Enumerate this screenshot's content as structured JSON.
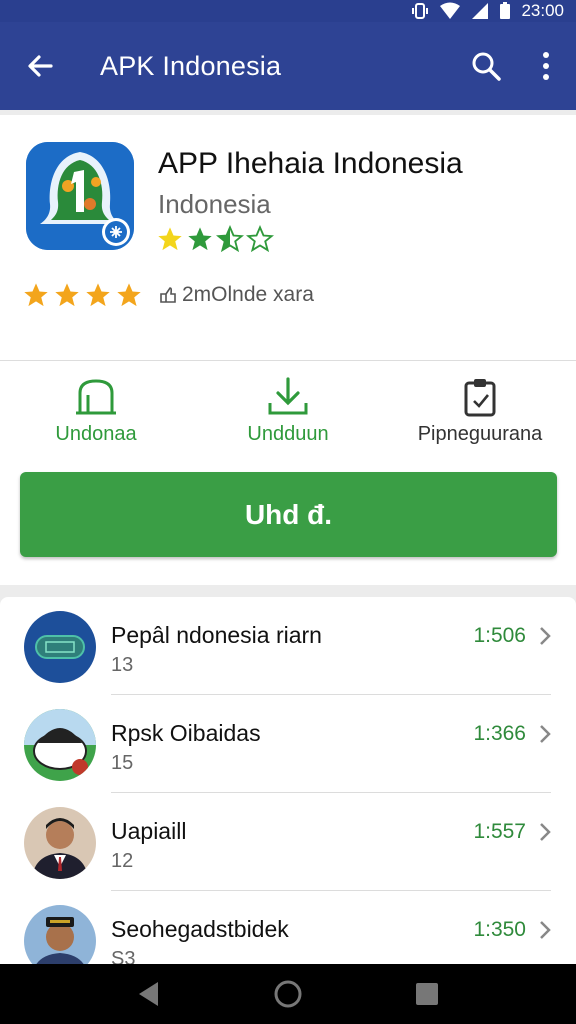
{
  "status_bar": {
    "time": "23:00"
  },
  "app_bar": {
    "title": "APK Indonesia",
    "back_icon": "arrow-left-icon",
    "search_icon": "search-icon",
    "more_icon": "more-vert-icon"
  },
  "app": {
    "name": "APP Ihehaia Indonesia",
    "developer": "Indonesia",
    "small_rating_stars": 3.5,
    "big_rating_stars": 4,
    "meta_text": "2mOlnde xara"
  },
  "actions": [
    {
      "label": "Undonaa",
      "icon": "bag-icon",
      "color": "#2f9a3b"
    },
    {
      "label": "Undduun",
      "icon": "download-icon",
      "color": "#2f9a3b"
    },
    {
      "label": "Pipneguurana",
      "icon": "clipboard-icon",
      "color": "#333333"
    }
  ],
  "install_button": {
    "label": "Uhd đ."
  },
  "list": [
    {
      "name": "Pepâl ndonesia riarn",
      "sub": "13",
      "value": "1:506"
    },
    {
      "name": "Rpsk Oibaidas",
      "sub": "15",
      "value": "1:366"
    },
    {
      "name": "Uapiaill",
      "sub": "12",
      "value": "1:557"
    },
    {
      "name": "Seohegadstbidek",
      "sub": "S3",
      "value": "1:350"
    }
  ],
  "colors": {
    "app_bar": "#2e4394",
    "accent_green": "#3a9e45",
    "value_green": "#2f8a3b"
  }
}
